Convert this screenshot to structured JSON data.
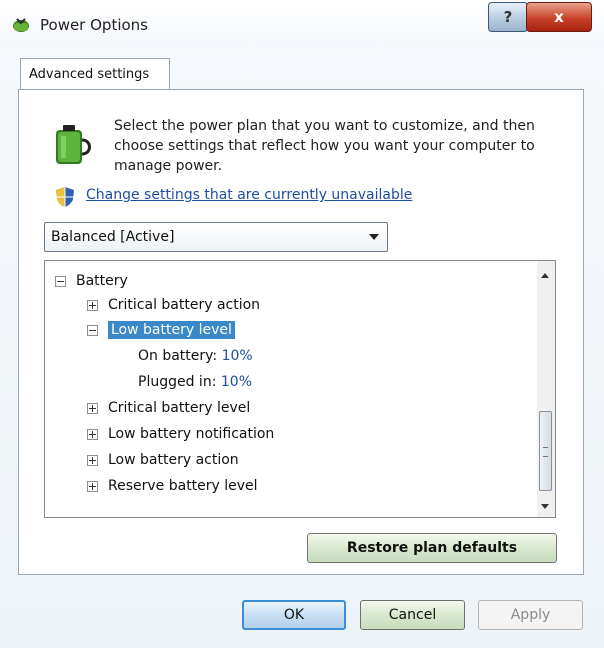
{
  "window": {
    "title": "Power Options",
    "help_glyph": "?",
    "close_glyph": "x",
    "icon": "power-options-icon"
  },
  "tabs": [
    {
      "label": "Advanced settings",
      "selected": true
    }
  ],
  "intro": {
    "text": "Select the power plan that you want to customize, and then choose settings that reflect how you want your computer to manage power.",
    "icon": "battery-plug-icon"
  },
  "change_link": {
    "label": "Change settings that are currently unavailable",
    "icon": "uac-shield-icon"
  },
  "plan_select": {
    "value": "Balanced [Active]"
  },
  "tree": {
    "root": "Battery",
    "items": [
      {
        "label": "Critical battery action",
        "expanded": false
      },
      {
        "label": "Low battery level",
        "expanded": true,
        "selected": true
      },
      {
        "label": "Critical battery level",
        "expanded": false
      },
      {
        "label": "Low battery notification",
        "expanded": false
      },
      {
        "label": "Low battery action",
        "expanded": false
      },
      {
        "label": "Reserve battery level",
        "expanded": false
      }
    ],
    "low_battery_level": {
      "on_battery_label": "On battery:",
      "on_battery_value": "10%",
      "plugged_in_label": "Plugged in:",
      "plugged_in_value": "10%"
    }
  },
  "buttons": {
    "restore": "Restore plan defaults",
    "ok": "OK",
    "cancel": "Cancel",
    "apply": "Apply"
  },
  "colors": {
    "selection": "#3a88c7",
    "link": "#1f4fa0",
    "close_red": "#c8432a"
  }
}
